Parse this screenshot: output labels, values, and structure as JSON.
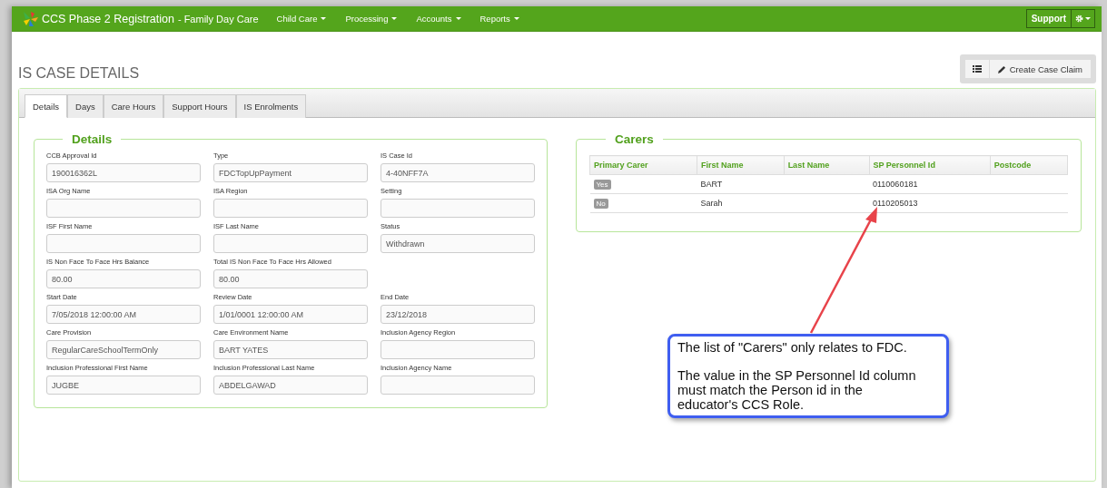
{
  "navbar": {
    "title": "CCS Phase 2 Registration",
    "subtitle": "- Family Day Care",
    "menus": [
      {
        "label": "Child Care"
      },
      {
        "label": "Processing"
      },
      {
        "label": "Accounts"
      },
      {
        "label": "Reports"
      }
    ],
    "support": "Support"
  },
  "page": {
    "title": "IS CASE DETAILS",
    "create_button": "Create Case Claim"
  },
  "tabs": [
    {
      "label": "Details",
      "selected": true
    },
    {
      "label": "Days",
      "selected": false
    },
    {
      "label": "Care Hours",
      "selected": false
    },
    {
      "label": "Support Hours",
      "selected": false
    },
    {
      "label": "IS Enrolments",
      "selected": false
    }
  ],
  "details": {
    "legend": "Details",
    "fields": [
      {
        "label": "CCB Approval Id",
        "value": "190016362L"
      },
      {
        "label": "Type",
        "value": "FDCTopUpPayment"
      },
      {
        "label": "IS Case Id",
        "value": "4-40NFF7A"
      },
      {
        "label": "ISA Org Name"
      },
      {
        "label": "ISA Region"
      },
      {
        "label": "Setting"
      },
      {
        "label": "ISF First Name"
      },
      {
        "label": "ISF Last Name"
      },
      {
        "label": "Status",
        "value": "Withdrawn"
      },
      {
        "label": "IS Non Face To Face Hrs Balance",
        "value": "80.00"
      },
      {
        "label": "Total IS Non Face To Face Hrs Allowed",
        "value": "80.00"
      },
      {
        "kind": "blank"
      },
      {
        "label": "Start Date",
        "value": "7/05/2018 12:00:00 AM"
      },
      {
        "label": "Review Date",
        "value": "1/01/0001 12:00:00 AM"
      },
      {
        "label": "End Date",
        "value": "23/12/2018"
      },
      {
        "label": "Care Provision",
        "value": "RegularCareSchoolTermOnly"
      },
      {
        "label": "Care Environment Name",
        "value": "BART YATES"
      },
      {
        "label": "Inclusion Agency Region"
      },
      {
        "label": "Inclusion Professional First Name",
        "value": "JUGBE"
      },
      {
        "label": "Inclusion Professional Last Name",
        "value": "ABDELGAWAD"
      },
      {
        "label": "Inclusion Agency Name"
      }
    ]
  },
  "carers": {
    "legend": "Carers",
    "columns": [
      "Primary Carer",
      "First Name",
      "Last Name",
      "SP Personnel Id",
      "Postcode"
    ],
    "rows": [
      {
        "primary_carer": "Yes",
        "first_name": "BART",
        "sp_personnel_id": "0110060181"
      },
      {
        "primary_carer": "No",
        "first_name": "Sarah",
        "sp_personnel_id": "0110205013"
      }
    ]
  },
  "callout": {
    "paragraphs": [
      "The list of \"Carers\" only relates to FDC.",
      "The value in the SP Personnel Id column must match the Person id in the educator's CCS Role."
    ]
  }
}
